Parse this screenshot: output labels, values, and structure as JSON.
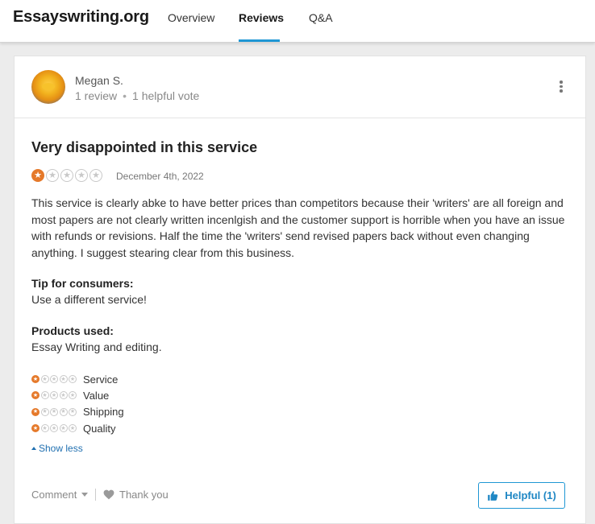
{
  "header": {
    "brand": "Essayswriting.org",
    "tabs": [
      {
        "label": "Overview",
        "active": false
      },
      {
        "label": "Reviews",
        "active": true
      },
      {
        "label": "Q&A",
        "active": false
      }
    ]
  },
  "review": {
    "reviewer": {
      "name": "Megan S.",
      "review_count": "1 review",
      "separator": "•",
      "helpful_votes": "1 helpful vote",
      "avatar_icon": "sunflower-avatar"
    },
    "title": "Very disappointed in this service",
    "rating": 1,
    "rating_max": 5,
    "date": "December 4th, 2022",
    "body": "This service is clearly abke to have better prices than competitors because their 'writers' are all foreign and most papers are not clearly written incenlgish and the customer support is horrible when you have an issue with refunds or revisions. Half the time the 'writers' send revised papers back without even changing anything. I suggest stearing clear from this business.",
    "tip_label": "Tip for consumers:",
    "tip_value": "Use a different service!",
    "products_label": "Products used:",
    "products_value": "Essay Writing and editing.",
    "sub_ratings": [
      {
        "label": "Service",
        "rating": 1
      },
      {
        "label": "Value",
        "rating": 1
      },
      {
        "label": "Shipping",
        "rating": 1
      },
      {
        "label": "Quality",
        "rating": 1
      }
    ],
    "show_less": "Show less"
  },
  "actions": {
    "comment": "Comment",
    "thank_you": "Thank you",
    "helpful": "Helpful (1)"
  },
  "colors": {
    "accent": "#1f97d4",
    "star_filled": "#e5792a",
    "star_empty": "#c8c8c8",
    "link": "#1f6fb0"
  }
}
